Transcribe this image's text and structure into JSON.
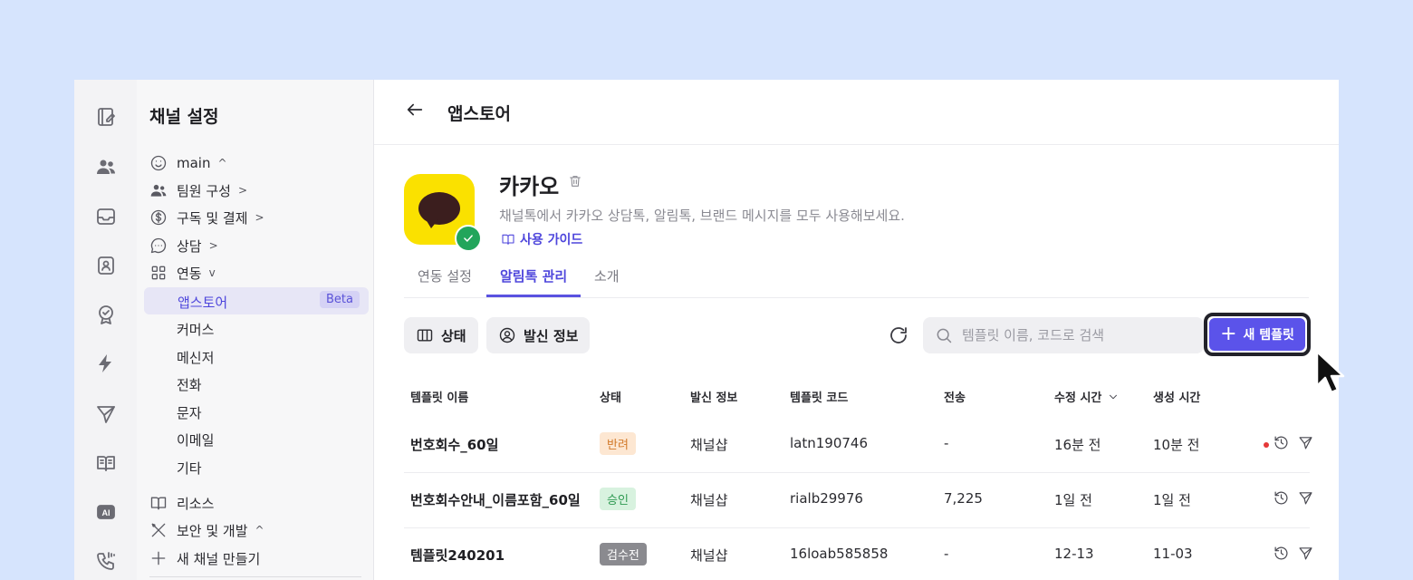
{
  "rail": {
    "icons": [
      "note-edit-icon",
      "team-icon",
      "inbox-icon",
      "contact-book-icon",
      "badge-check-icon",
      "lightning-icon",
      "send-icon",
      "book-icon",
      "ai-icon",
      "phone-wave-icon"
    ]
  },
  "sidebar": {
    "title": "채널 설정",
    "items": [
      {
        "label": "main",
        "icon": "smile-icon",
        "chevron": "^"
      },
      {
        "label": "팀원 구성",
        "icon": "users-icon",
        "chevron": ">"
      },
      {
        "label": "구독 및 결제",
        "icon": "dollar-circle-icon",
        "chevron": ">"
      },
      {
        "label": "상담",
        "icon": "chat-bubble-icon",
        "chevron": ">"
      },
      {
        "label": "연동",
        "icon": "grid-icon",
        "chevron": "v"
      }
    ],
    "sub_items": [
      "앱스토어",
      "커머스",
      "메신저",
      "전화",
      "문자",
      "이메일",
      "기타"
    ],
    "active_sub": "앱스토어",
    "beta_badge": "Beta",
    "bottom_items": [
      {
        "label": "리소스",
        "icon": "book-open-icon"
      },
      {
        "label": "보안 및 개발",
        "icon": "tools-icon",
        "chevron": "^"
      },
      {
        "label": "새 채널 만들기",
        "icon": "plus-icon"
      }
    ]
  },
  "header": {
    "title": "앱스토어"
  },
  "app": {
    "name": "카카오",
    "description": "채널톡에서 카카오 상담톡, 알림톡, 브랜드 메시지를 모두 사용해보세요.",
    "guide_link": "사용 가이드",
    "logo_color": "#fae100",
    "verified": true
  },
  "tabs": [
    {
      "label": "연동 설정",
      "active": false
    },
    {
      "label": "알림톡 관리",
      "active": true
    },
    {
      "label": "소개",
      "active": false
    }
  ],
  "toolbar": {
    "status_button": "상태",
    "sender_button": "발신 정보",
    "search_placeholder": "템플릿 이름, 코드로 검색",
    "new_template_button": "새 템플릿",
    "accent": "#5b53ea"
  },
  "table": {
    "headers": [
      "템플릿 이름",
      "상태",
      "발신 정보",
      "템플릿 코드",
      "전송",
      "수정 시간",
      "생성 시간"
    ],
    "rows": [
      {
        "name": "번호회수_60일",
        "status": "반려",
        "sender": "채널샵",
        "code": "latn190746",
        "sent": "-",
        "modified": "16분 전",
        "created": "10분 전",
        "alert": true
      },
      {
        "name": "번호회수안내_이름포함_60일",
        "status": "승인",
        "sender": "채널샵",
        "code": "rialb29976",
        "sent": "7,225",
        "modified": "1일 전",
        "created": "1일 전",
        "alert": false
      },
      {
        "name": "템플릿240201",
        "status": "검수전",
        "sender": "채널샵",
        "code": "16loab585858",
        "sent": "-",
        "modified": "12-13",
        "created": "11-03",
        "alert": false
      }
    ]
  }
}
